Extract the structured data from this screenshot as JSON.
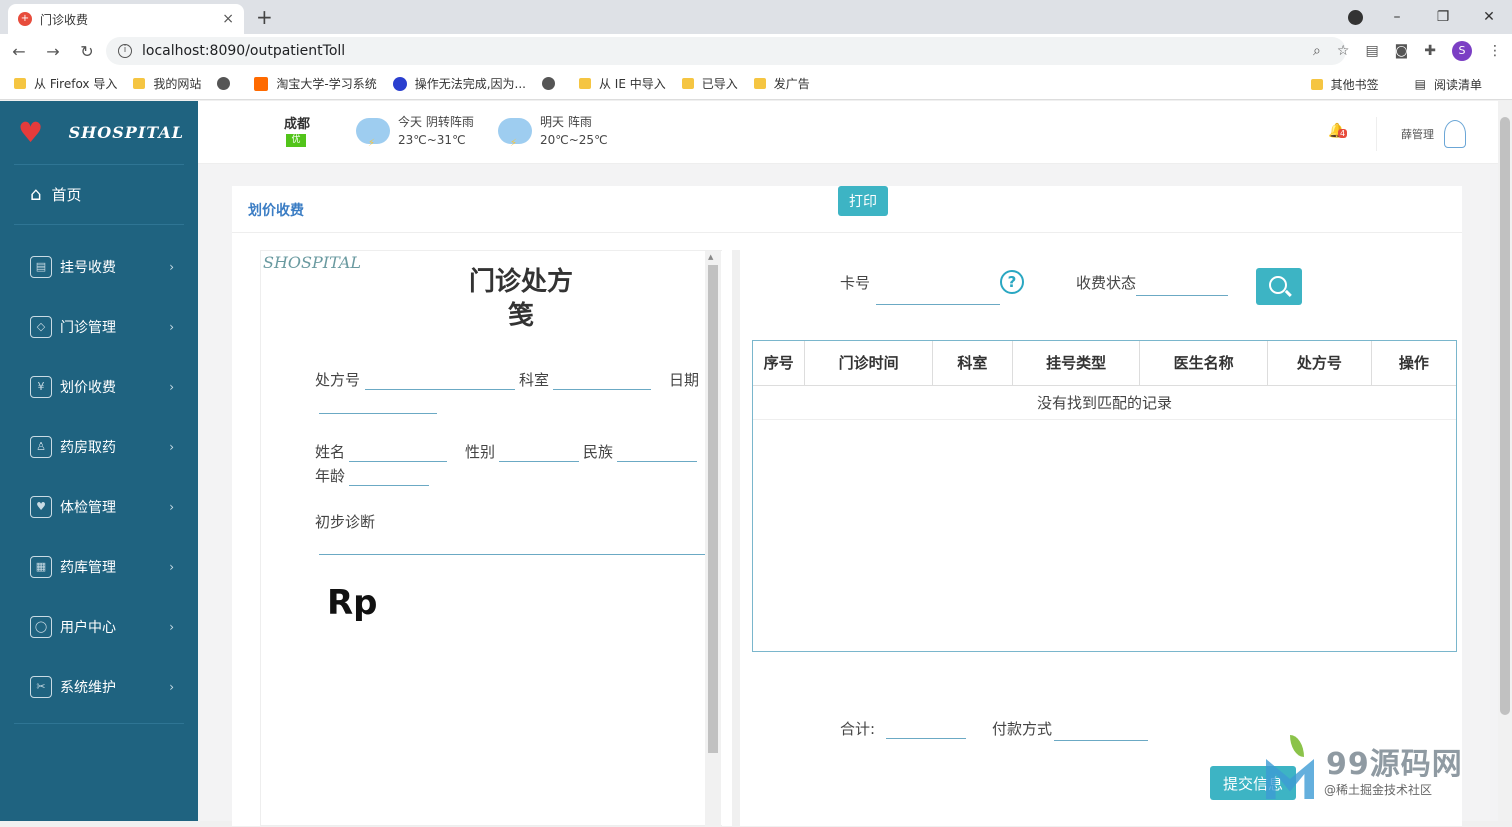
{
  "browser": {
    "tab_title": "门诊收费",
    "tab_close": "×",
    "new_tab": "+",
    "url": "localhost:8090/outpatientToll",
    "url_host": "localhost",
    "bookmarks": [
      {
        "label": "从 Firefox 导入",
        "icon": "folder-icon"
      },
      {
        "label": "我的网站",
        "icon": "folder-icon"
      },
      {
        "label": "",
        "icon": "globe-icon"
      },
      {
        "label": "淘宝大学-学习系统",
        "icon": "taobao-icon"
      },
      {
        "label": "操作无法完成,因为...",
        "icon": "baidu-icon"
      },
      {
        "label": "",
        "icon": "globe-icon"
      },
      {
        "label": "从 IE 中导入",
        "icon": "folder-icon"
      },
      {
        "label": "已导入",
        "icon": "folder-icon"
      },
      {
        "label": "发广告",
        "icon": "folder-icon"
      }
    ],
    "other_bookmarks": "其他书签",
    "reading_list": "阅读清单",
    "profile_initial": "S"
  },
  "sidebar": {
    "logo_text": "SHOSPITAL",
    "home_label": "首页",
    "items": [
      {
        "label": "挂号收费",
        "icon": "register-icon"
      },
      {
        "label": "门诊管理",
        "icon": "clinic-icon"
      },
      {
        "label": "划价收费",
        "icon": "pricing-icon"
      },
      {
        "label": "药房取药",
        "icon": "pharmacy-icon"
      },
      {
        "label": "体检管理",
        "icon": "checkup-icon"
      },
      {
        "label": "药库管理",
        "icon": "warehouse-icon"
      },
      {
        "label": "用户中心",
        "icon": "user-icon"
      },
      {
        "label": "系统维护",
        "icon": "tools-icon"
      }
    ]
  },
  "topbar": {
    "city": "成都",
    "aqi": "优",
    "today_label": "今天  阴转阵雨",
    "today_temp": "23℃~31℃",
    "tomorrow_label": "明天  阵雨",
    "tomorrow_temp": "20℃~25℃",
    "notification_count": "4",
    "admin_name": "薛管理"
  },
  "panel": {
    "title": "划价收费",
    "print_label": "打印"
  },
  "prescription": {
    "brand": "SHOSPITAL",
    "title": "门诊处方笺",
    "rx_no_label": "处方号",
    "dept_label": "科室",
    "date_label": "日期",
    "name_label": "姓名",
    "gender_label": "性别",
    "ethnic_label": "民族",
    "age_label": "年龄",
    "diagnosis_label": "初步诊断",
    "rp_label": "Rp"
  },
  "query": {
    "card_label": "卡号",
    "status_label": "收费状态"
  },
  "table": {
    "headers": [
      "序号",
      "门诊时间",
      "科室",
      "挂号类型",
      "医生名称",
      "处方号",
      "操作"
    ],
    "empty_message": "没有找到匹配的记录"
  },
  "footer": {
    "total_label": "合计:",
    "pay_method_label": "付款方式",
    "submit_label": "提交信息"
  },
  "watermark": {
    "brand": "99源码网",
    "sub": "@稀土掘金技术社区"
  }
}
